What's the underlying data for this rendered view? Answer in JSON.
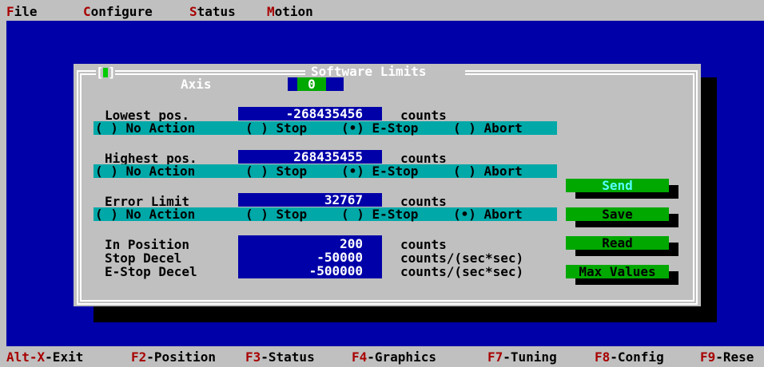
{
  "menubar": {
    "items": [
      {
        "hotkey": "F",
        "rest": "ile"
      },
      {
        "hotkey": "C",
        "rest": "onfigure"
      },
      {
        "hotkey": "S",
        "rest": "tatus"
      },
      {
        "hotkey": "M",
        "rest": "otion"
      }
    ]
  },
  "dialog": {
    "title": "Software Limits",
    "close_bracket_left": "[",
    "close_bracket_right": "]",
    "axis_label": "Axis",
    "axis_value": "0",
    "lowest": {
      "label": "Lowest pos.",
      "value": "-268435456",
      "unit": "counts",
      "selected": "E-Stop"
    },
    "highest": {
      "label": "Highest pos.",
      "value": "268435455",
      "unit": "counts",
      "selected": "E-Stop"
    },
    "error": {
      "label": "Error Limit",
      "value": "32767",
      "unit": "counts",
      "selected": "Abort"
    },
    "radio_options": {
      "no_action": "No Action",
      "stop": "Stop",
      "estop": "E-Stop",
      "abort": "Abort",
      "mark_on": "(•)",
      "mark_off": "( )"
    },
    "in_position": {
      "label": "In Position",
      "value": "200",
      "unit": "counts"
    },
    "stop_decel": {
      "label": "Stop Decel",
      "value": "-50000",
      "unit": "counts/(sec*sec)"
    },
    "estop_decel": {
      "label": "E-Stop Decel",
      "value": "-500000",
      "unit": "counts/(sec*sec)"
    },
    "buttons": {
      "send": "Send",
      "save": "Save",
      "read": "Read",
      "max_values": "Max Values"
    }
  },
  "statusbar": {
    "items": [
      {
        "key": "Alt-X",
        "label": "-Exit"
      },
      {
        "key": "F2",
        "label": "-Position"
      },
      {
        "key": "F3",
        "label": "-Status"
      },
      {
        "key": "F4",
        "label": "-Graphics"
      },
      {
        "key": "F7",
        "label": "-Tuning"
      },
      {
        "key": "F8",
        "label": "-Config"
      },
      {
        "key": "F9",
        "label": "-Rese"
      }
    ]
  },
  "colors": {
    "desktop": "#0000a8",
    "surface": "#c0c0c0",
    "field": "#0000a8",
    "radio_row": "#00a8a8",
    "button": "#00a800",
    "hotkey": "#a80000"
  }
}
